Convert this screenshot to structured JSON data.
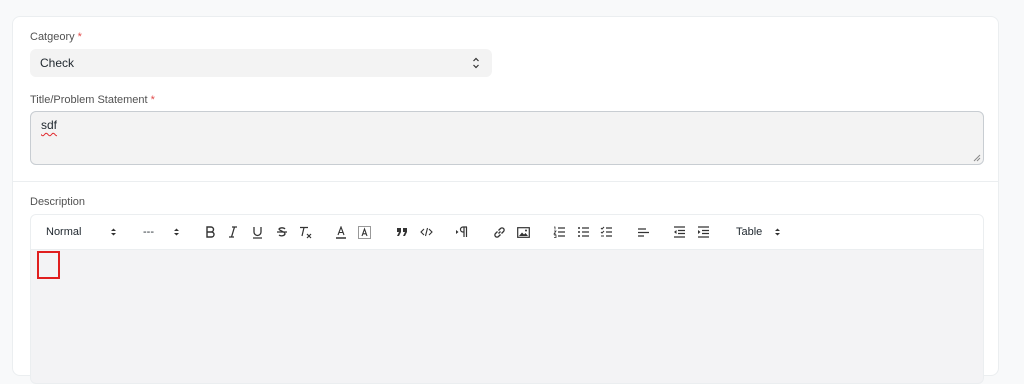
{
  "category": {
    "label": "Catgeory",
    "required_mark": "*",
    "selected": "Check"
  },
  "title_field": {
    "label": "Title/Problem Statement",
    "required_mark": "*",
    "value": "sdf"
  },
  "description": {
    "label": "Description",
    "toolbar": {
      "paragraph_style": "Normal",
      "font_size": "---",
      "table_label": "Table"
    }
  },
  "colors": {
    "required": "#e24c4c",
    "focus_outline": "#e01e1e",
    "field_bg": "#f3f3f3"
  }
}
